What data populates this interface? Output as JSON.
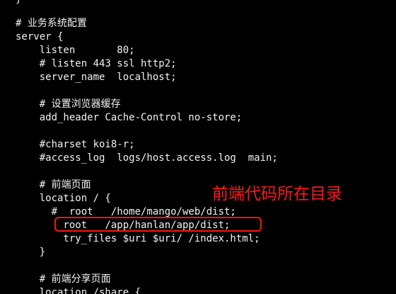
{
  "terminal": {
    "lines": [
      "}",
      "# 业务系统配置",
      "server {",
      "    listen       80;",
      "    # listen 443 ssl http2;",
      "    server_name  localhost;",
      "",
      "    # 设置浏览器缓存",
      "    add_header Cache-Control no-store;",
      "",
      "    #charset koi8-r;",
      "    #access_log  logs/host.access.log  main;",
      "",
      "    # 前端页面",
      "    location / {",
      "      #  root   /home/mango/web/dist;",
      "        root   /app/hanlan/app/dist;",
      "        try_files $uri $uri/ /index.html;",
      "    }",
      "",
      "    # 前端分享页面",
      "    location /share {"
    ]
  },
  "annotation": {
    "text": "前端代码所在目录",
    "color": "#ff1a1a"
  },
  "colors": {
    "background": "#000000",
    "text": "#f2f2f2",
    "highlight_border": "#ff1414"
  }
}
